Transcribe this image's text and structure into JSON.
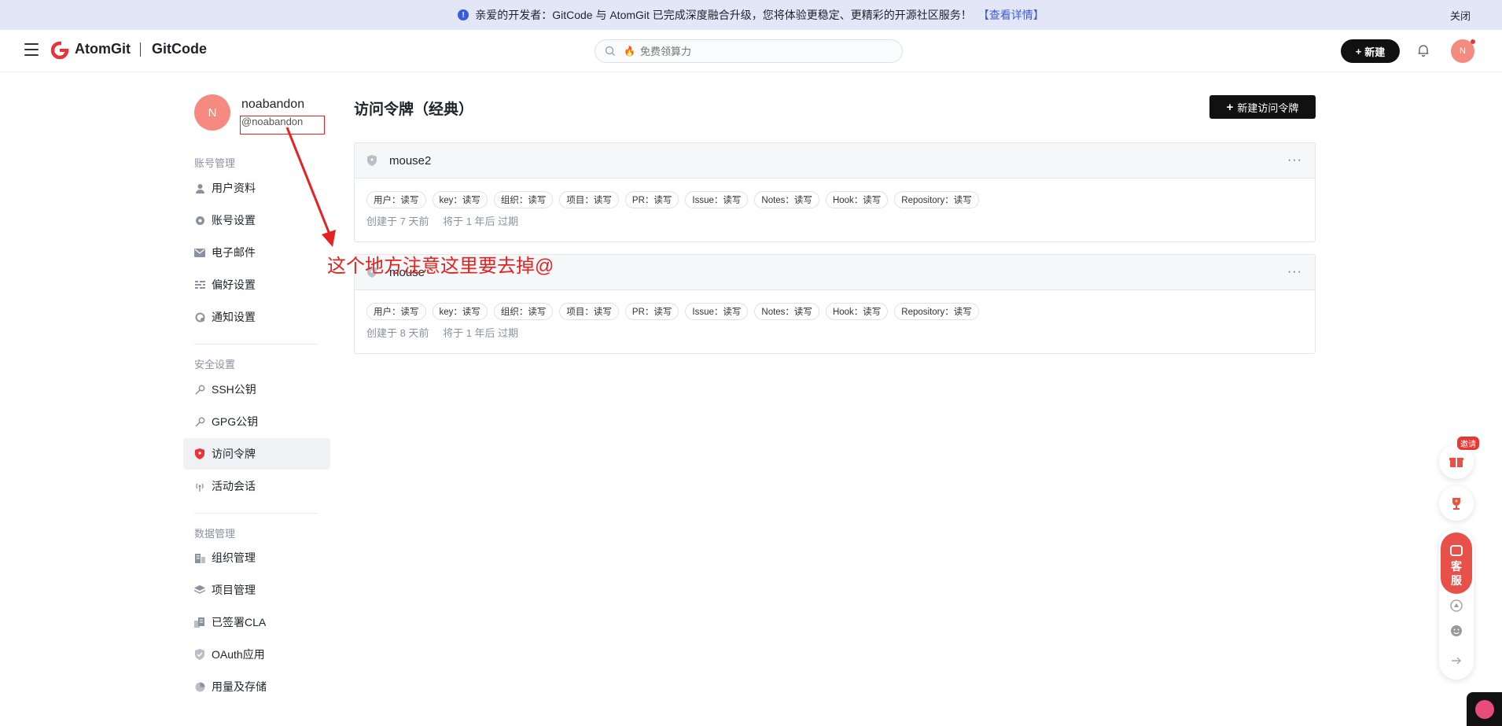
{
  "banner": {
    "message": "亲爱的开发者：GitCode 与 AtomGit 已完成深度融合升级，您将体验更稳定、更精彩的开源社区服务！",
    "link": "【查看详情】",
    "close": "关闭"
  },
  "header": {
    "logo_primary": "AtomGit",
    "logo_secondary": "GitCode",
    "search_placeholder": "免费领算力",
    "new_button": "新建",
    "avatar_letter": "N"
  },
  "profile": {
    "avatar_letter": "N",
    "name": "noabandon",
    "handle": "@noabandon"
  },
  "sidebar": {
    "account_title": "账号管理",
    "account_items": [
      {
        "label": "用户资料",
        "icon": "user-icon"
      },
      {
        "label": "账号设置",
        "icon": "gear-icon"
      },
      {
        "label": "电子邮件",
        "icon": "mail-icon"
      },
      {
        "label": "偏好设置",
        "icon": "sliders-icon"
      },
      {
        "label": "通知设置",
        "icon": "notification-gear-icon"
      }
    ],
    "security_title": "安全设置",
    "security_items": [
      {
        "label": "SSH公钥",
        "icon": "key-icon"
      },
      {
        "label": "GPG公钥",
        "icon": "key-icon"
      },
      {
        "label": "访问令牌",
        "icon": "shield-icon"
      },
      {
        "label": "活动会话",
        "icon": "broadcast-icon"
      }
    ],
    "data_title": "数据管理",
    "data_items": [
      {
        "label": "组织管理",
        "icon": "building-icon"
      },
      {
        "label": "项目管理",
        "icon": "layers-icon"
      },
      {
        "label": "已签署CLA",
        "icon": "document-icon"
      },
      {
        "label": "OAuth应用",
        "icon": "shield-check-icon"
      },
      {
        "label": "用量及存储",
        "icon": "pie-chart-icon"
      }
    ]
  },
  "main": {
    "title": "访问令牌（经典）",
    "create_button": "新建访问令牌",
    "tokens": [
      {
        "name": "mouse2",
        "scopes": [
          "用户：读写",
          "key：读写",
          "组织：读写",
          "项目：读写",
          "PR：读写",
          "Issue：读写",
          "Notes：读写",
          "Hook：读写",
          "Repository：读写"
        ],
        "created": "创建于 7 天前",
        "expires": "将于 1 年后 过期"
      },
      {
        "name": "mouse",
        "scopes": [
          "用户：读写",
          "key：读写",
          "组织：读写",
          "项目：读写",
          "PR：读写",
          "Issue：读写",
          "Notes：读写",
          "Hook：读写",
          "Repository：读写"
        ],
        "created": "创建于 8 天前",
        "expires": "将于 1 年后 过期"
      }
    ]
  },
  "annotation": {
    "text": "这个地方注意这里要去掉@",
    "color": "#e52222"
  },
  "floating": {
    "invite_badge": "邀请",
    "service_line1": "客",
    "service_line2": "服"
  },
  "colors": {
    "accent": "#3b5bdb",
    "avatar": "#f48a80",
    "banner_bg": "#e2e6f7"
  }
}
